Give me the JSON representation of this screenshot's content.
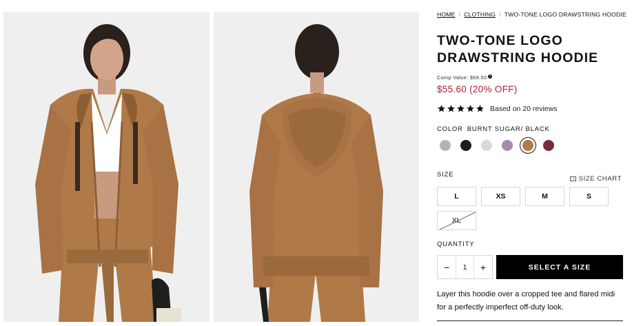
{
  "breadcrumb": {
    "items": [
      {
        "label": "HOME",
        "link": true
      },
      {
        "label": "CLOTHING",
        "link": true
      },
      {
        "label": "TWO-TONE LOGO DRAWSTRING HOODIE",
        "link": false
      }
    ],
    "separator": "/"
  },
  "product": {
    "title": "TWO-TONE LOGO DRAWSTRING HOODIE",
    "comp_value_label": "Comp Value: $69.50",
    "price_label": "$55.60 (20% OFF)",
    "price_color": "#b11e2d"
  },
  "reviews": {
    "rating": 5,
    "text": "Based on 20 reviews",
    "star_icon": "star-icon"
  },
  "color": {
    "label": "COLOR",
    "selected_name": "BURNT SUGAR/ BLACK",
    "swatches": [
      {
        "color": "#b4b4b8",
        "selected": false
      },
      {
        "color": "#1e1e20",
        "selected": false
      },
      {
        "color": "#ddd8d8",
        "selected": false
      },
      {
        "color": "#a88cb0",
        "selected": false
      },
      {
        "color": "#b07a48",
        "selected": true
      },
      {
        "color": "#7b2a3a",
        "selected": false
      }
    ]
  },
  "size": {
    "label": "SIZE",
    "chart_label": "SIZE CHART",
    "chart_icon": "ruler-icon",
    "options": [
      {
        "label": "L",
        "available": true
      },
      {
        "label": "XS",
        "available": true
      },
      {
        "label": "M",
        "available": true
      },
      {
        "label": "S",
        "available": true
      },
      {
        "label": "XL",
        "available": false
      }
    ]
  },
  "quantity": {
    "label": "QUANTITY",
    "value": "1",
    "minus": "−",
    "plus": "+"
  },
  "cta": {
    "label": "SELECT A SIZE"
  },
  "description": "Layer this hoodie over a cropped tee and flared midi for a perfectly imperfect off-duty look.",
  "images": {
    "photo_bg": "#efefef",
    "garment_color": "#b07a48",
    "garment_shadow": "#8e5e33"
  }
}
